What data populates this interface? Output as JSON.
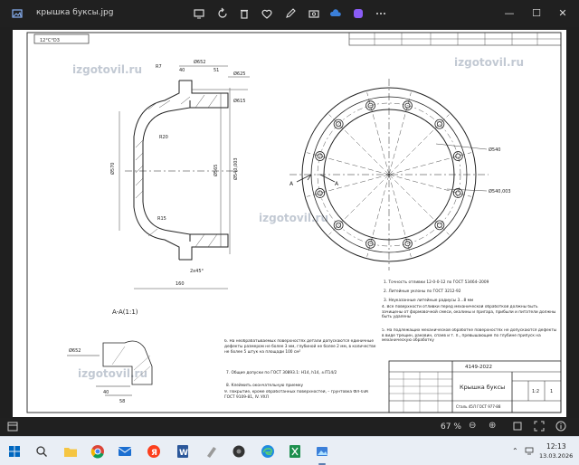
{
  "window": {
    "title": "крышка буксы.jpg"
  },
  "toolbar": {
    "icons": [
      "display-icon",
      "rotate-icon",
      "delete-icon",
      "favorite-icon",
      "edit-icon",
      "share-icon",
      "more-icon"
    ]
  },
  "window_controls": {
    "minimize": "—",
    "maximize": "☐",
    "close": "✕"
  },
  "watermarks": [
    "izgotovil.ru",
    "izgotovil.ru",
    "izgotovil.ru",
    "izgotovil.ru"
  ],
  "drawing": {
    "stamp_top": "12°C°D3",
    "dims": {
      "d652": "Ø652",
      "d625": "Ø625",
      "d615": "Ø615",
      "r20": "R20",
      "r15": "R15",
      "r7": "R7",
      "d570": "Ø570",
      "d565": "Ø565",
      "len160": "160",
      "len2x45": "2x45°",
      "d40": "40",
      "d58": "58",
      "d51": "51",
      "d540": "Ø540",
      "d543": "Ø540,003",
      "a": "A"
    },
    "section_label": "A-A(1:1)",
    "notes": [
      "1. Точность отливки 12-0-0-12 по ГОСТ 53464–2009",
      "2. Литейные уклоны по ГОСТ 3212-92",
      "3. Неуказанные литейные радиусы 3…8 мм",
      "4. Все поверхности отливки перед механической обработкой должны быть зачищены от формовочной смеси, окалины и пригара, прибыли и питатели должны быть удалены",
      "5. На подлежащих механической обработке поверхностях не допускаются дефекты в виде трещин, раковин, спаев и т. п., превышающие по глубине припуск на механическую обработку",
      "6. На необрабатываемых поверхностях детали допускаются единичные дефекты размером не более 3 мм, глубиной не более 2 мм, в количестве не более 5 штук на площади 100 см²",
      "7. Общие допуски по ГОСТ 30893.1: H14, h14, ±IT14/2",
      "8. Клеймить окончательную приемку",
      "9. Покрытие, кроме обработанных поверхностей, – грунтовка ФЛ-03К ГОСТ 9109-81, IV. УХЛ"
    ],
    "title_block": {
      "code": "4149-2022",
      "name": "Крышка буксы",
      "material": "Сталь 45Л ГОСТ 977-88",
      "scale": "1:2",
      "sheet": "1"
    }
  },
  "status": {
    "zoom": "67 %"
  },
  "taskbar": {
    "apps": [
      "windows-icon",
      "search-icon",
      "file-explorer-icon",
      "chrome-icon",
      "mail-icon",
      "word-icon",
      "paint-icon",
      "camera-icon",
      "edge-icon",
      "spreadsheet-icon",
      "photos-icon"
    ],
    "time": "12:13",
    "date": "13.03.2026"
  }
}
